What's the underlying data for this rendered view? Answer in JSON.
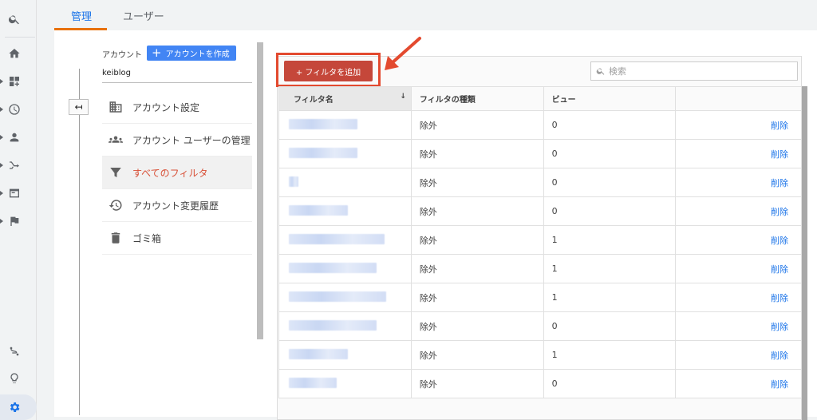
{
  "tabs": {
    "admin": "管理",
    "users": "ユーザー"
  },
  "account": {
    "label": "アカウント",
    "create_button": "アカウントを作成",
    "create_icon": "plus-icon",
    "name": "keiblog"
  },
  "back_button_icon": "back-arrow-icon",
  "menu": {
    "items": [
      {
        "label": "アカウント設定",
        "icon": "building-icon"
      },
      {
        "label": "アカウント ユーザーの管理",
        "icon": "people-icon"
      },
      {
        "label": "すべてのフィルタ",
        "icon": "filter-icon",
        "active": true
      },
      {
        "label": "アカウント変更履歴",
        "icon": "history-icon"
      },
      {
        "label": "ゴミ箱",
        "icon": "trash-icon"
      }
    ]
  },
  "toolbar": {
    "add_filter": "+ フィルタを追加",
    "search_placeholder": "検索",
    "search_icon": "search-icon"
  },
  "table": {
    "headers": {
      "name": "フィルタ名",
      "name_sort_icon": "sort-down-icon",
      "type": "フィルタの種類",
      "views": "ビュー"
    },
    "rows": [
      {
        "type": "除外",
        "views": "0",
        "action": "削除"
      },
      {
        "type": "除外",
        "views": "0",
        "action": "削除"
      },
      {
        "type": "除外",
        "views": "0",
        "action": "削除"
      },
      {
        "type": "除外",
        "views": "0",
        "action": "削除"
      },
      {
        "type": "除外",
        "views": "1",
        "action": "削除"
      },
      {
        "type": "除外",
        "views": "1",
        "action": "削除"
      },
      {
        "type": "除外",
        "views": "1",
        "action": "削除"
      },
      {
        "type": "除外",
        "views": "0",
        "action": "削除"
      },
      {
        "type": "除外",
        "views": "1",
        "action": "削除"
      },
      {
        "type": "除外",
        "views": "0",
        "action": "削除"
      }
    ]
  },
  "colors": {
    "accent_blue": "#1a73e8",
    "add_button_red": "#c5473a",
    "highlight_red": "#e34a2f",
    "active_menu_text": "#d84e35",
    "tab_underline": "#e8710a"
  }
}
